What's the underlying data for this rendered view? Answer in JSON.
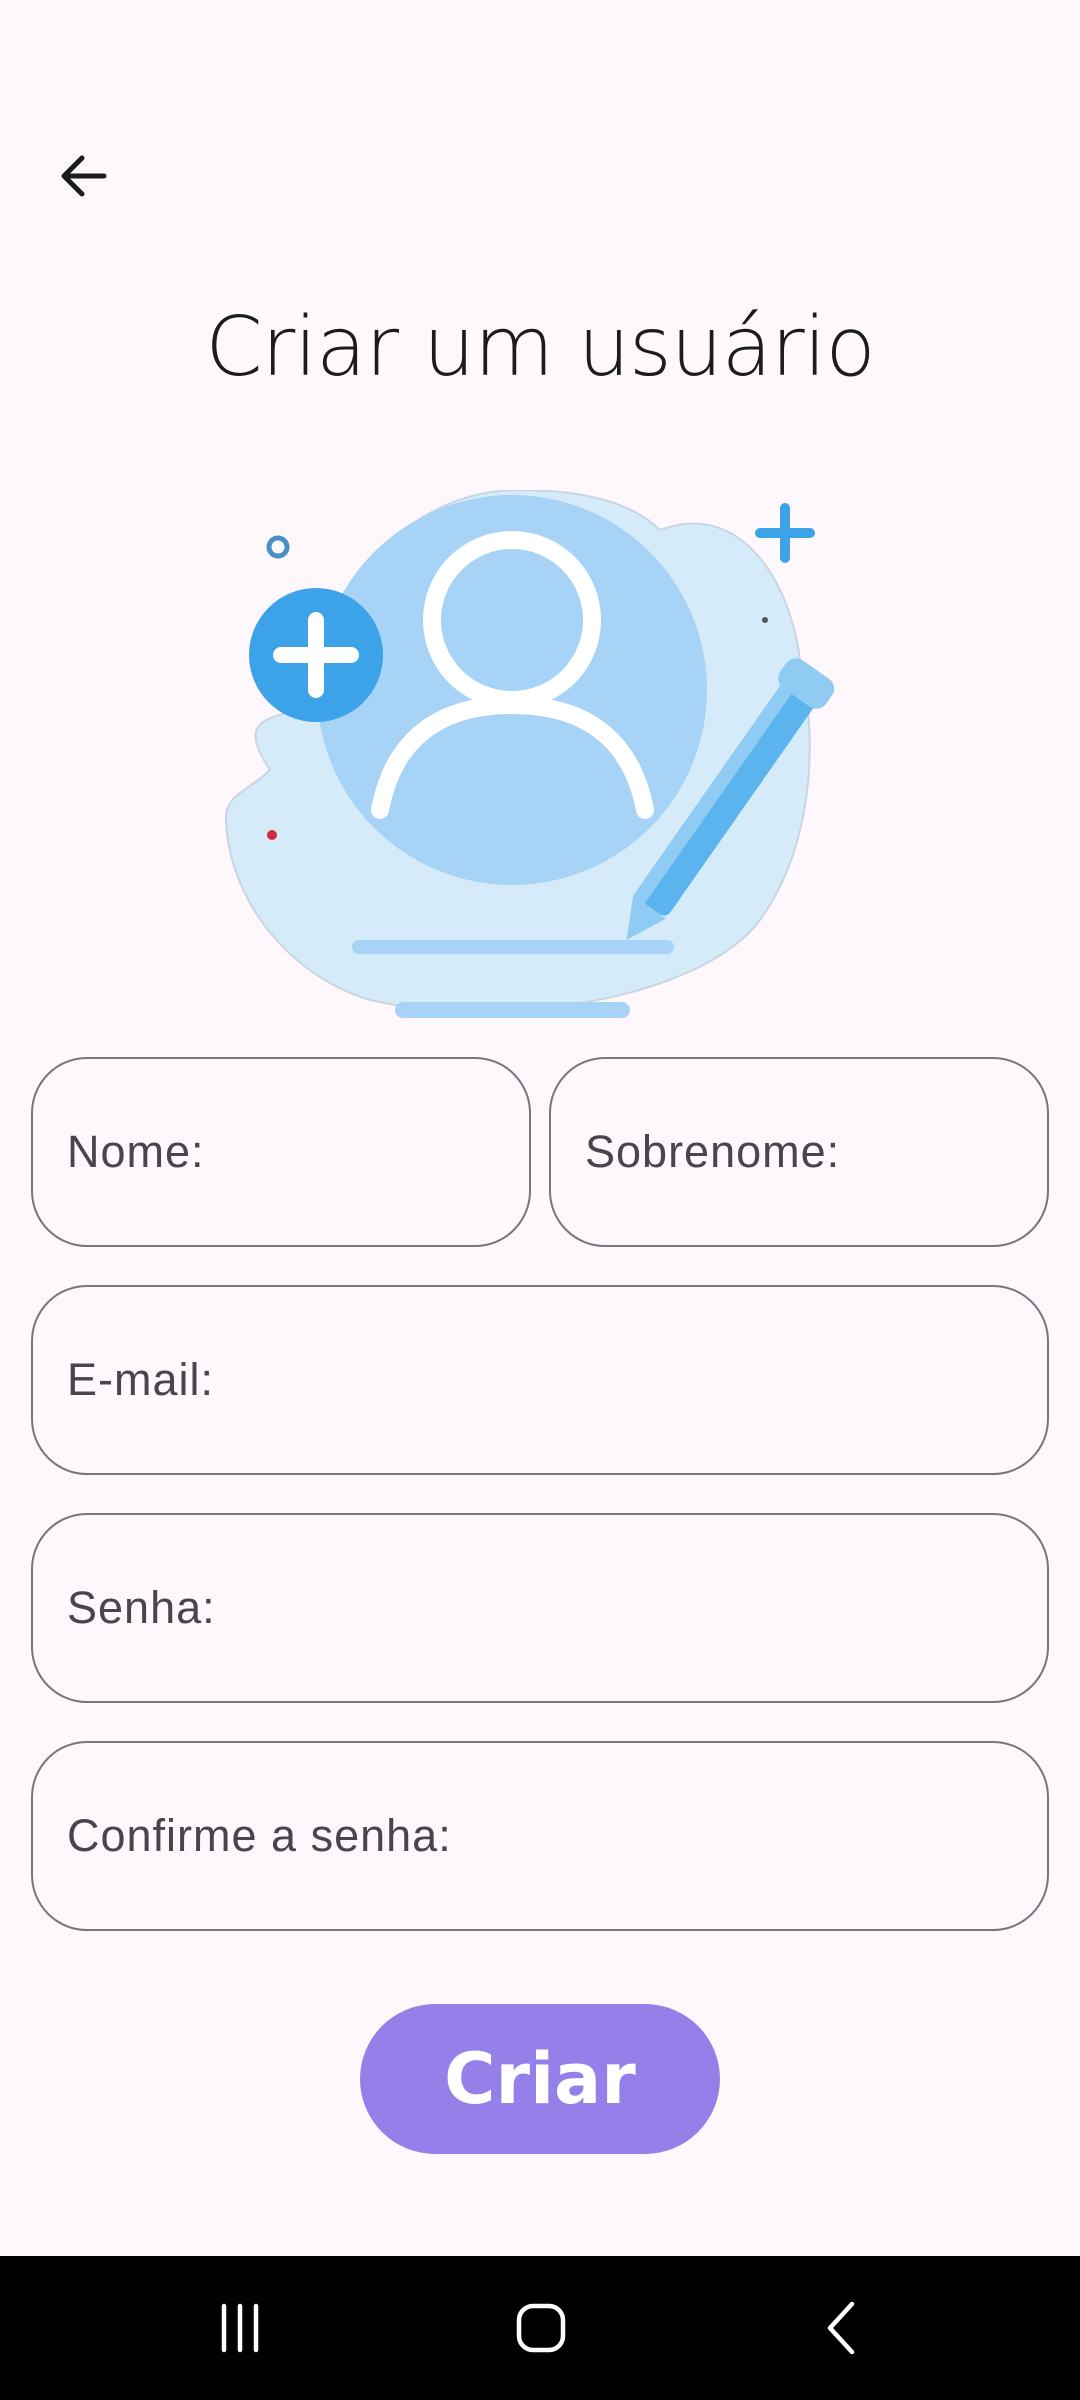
{
  "header": {
    "title": "Criar um usuário"
  },
  "icons": {
    "back": "arrow-left-icon",
    "illustration": "add-user-illustration",
    "recents": "recent-apps-icon",
    "home": "home-icon",
    "nav_back": "chevron-left-icon"
  },
  "form": {
    "first_name_placeholder": "Nome:",
    "last_name_placeholder": "Sobrenome:",
    "email_placeholder": "E-mail:",
    "password_placeholder": "Senha:",
    "confirm_password_placeholder": "Confirme a senha:",
    "submit_label": "Criar"
  },
  "colors": {
    "background": "#FEF7FC",
    "accent": "#9580EA",
    "field_border": "#79747E",
    "illustration_blue": "#3DA3E8"
  }
}
